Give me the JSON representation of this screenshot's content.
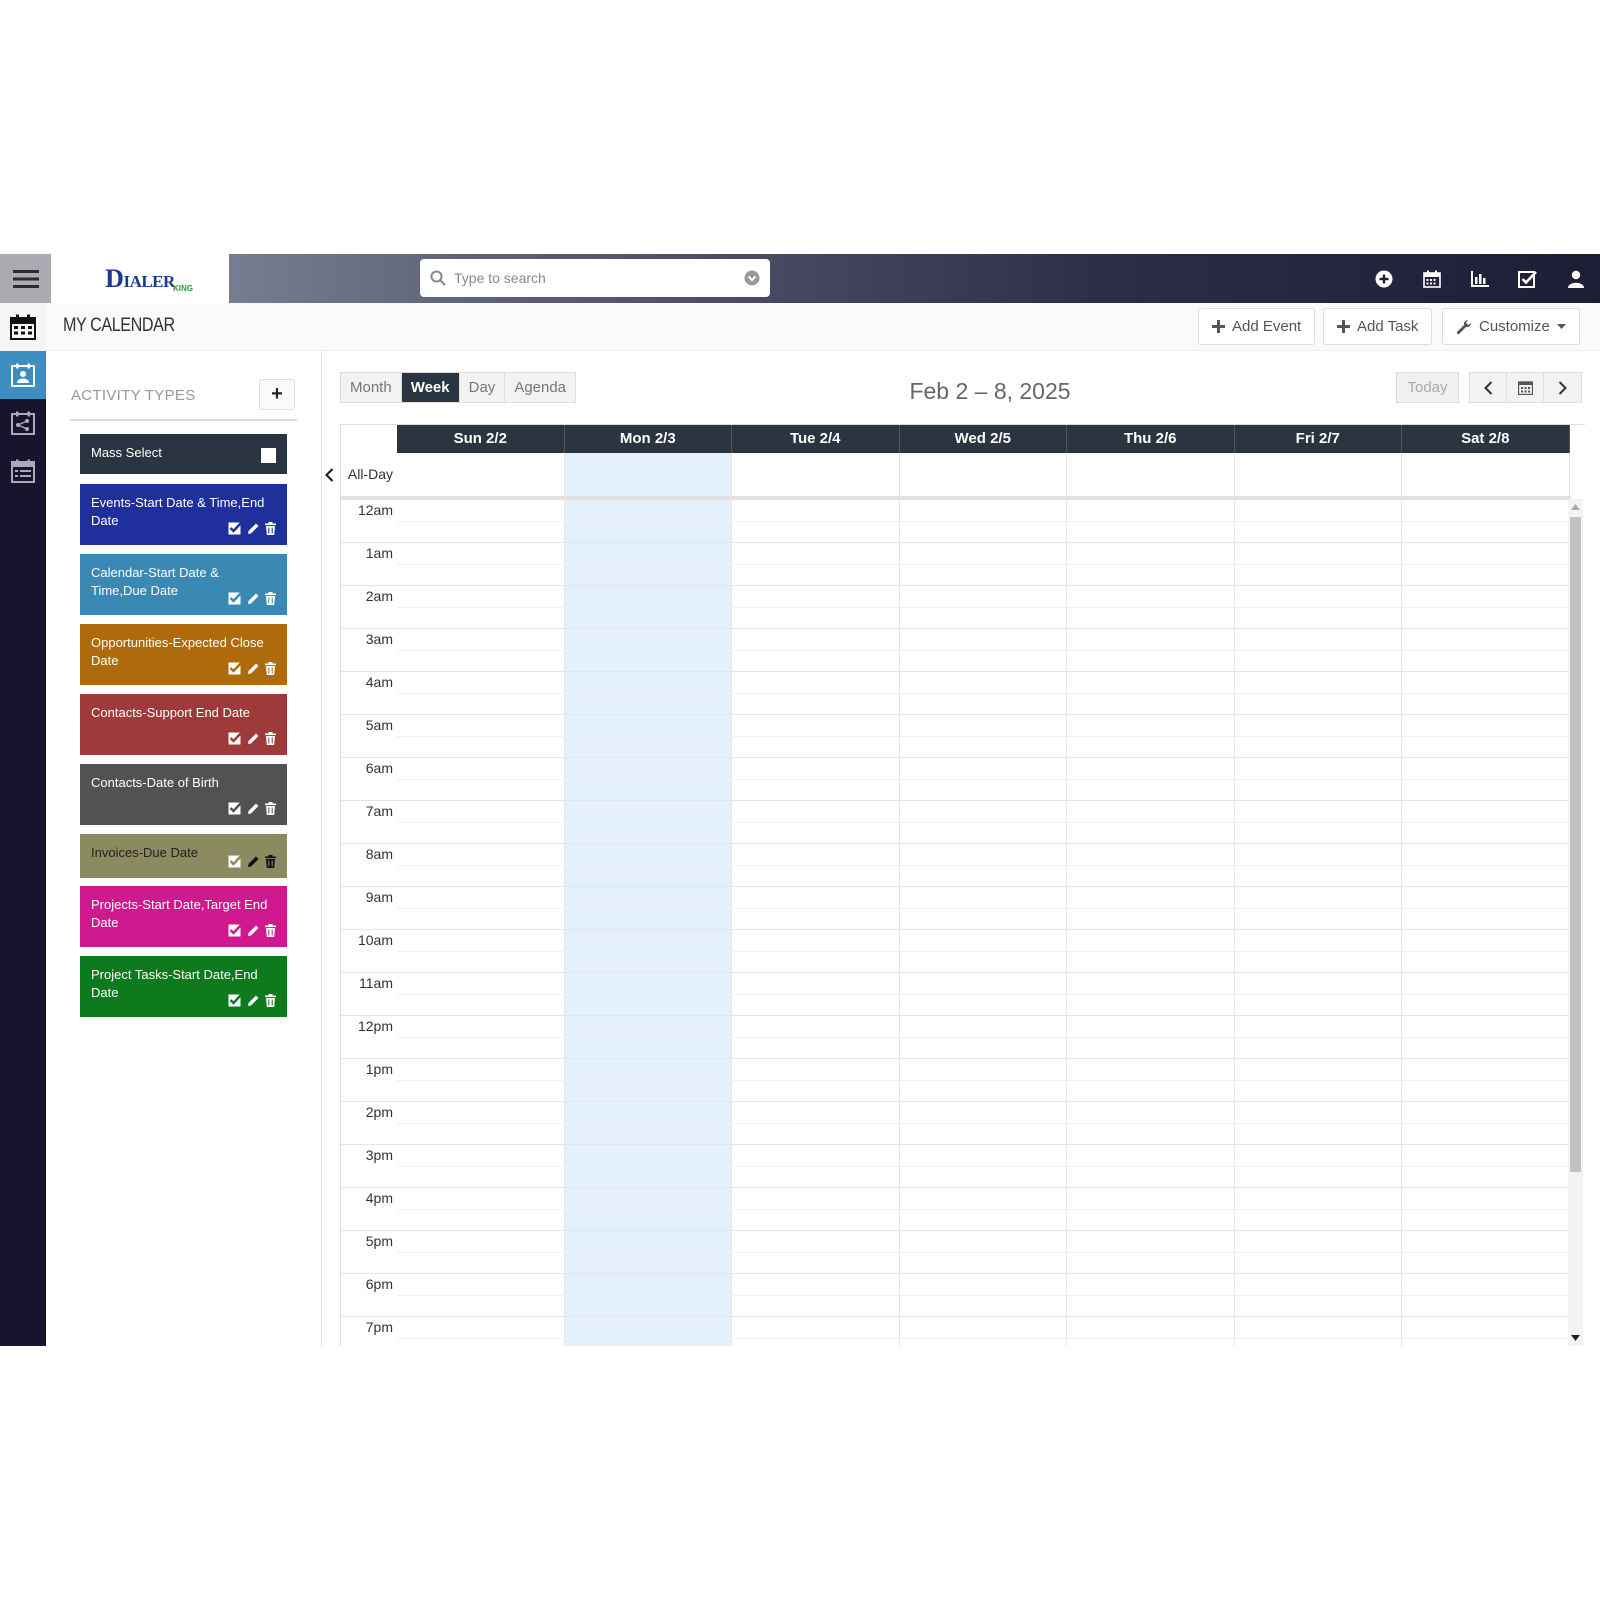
{
  "app": {
    "logo_main": "IALER",
    "logo_letter": "D",
    "logo_sub": "KING"
  },
  "search": {
    "placeholder": "Type to search"
  },
  "top_icons": [
    "plus-circle-icon",
    "calendar-icon",
    "bar-chart-icon",
    "checkbox-icon",
    "user-icon"
  ],
  "page": {
    "title": "MY CALENDAR",
    "add_event": "Add Event",
    "add_task": "Add Task",
    "customize": "Customize"
  },
  "activity": {
    "title": "ACTIVITY TYPES",
    "add_label": "+",
    "mass_select": "Mass Select",
    "items": [
      {
        "label": "Events-Start Date & Time,End Date",
        "color": "#1f2f9c"
      },
      {
        "label": "Calendar-Start Date & Time,Due Date",
        "color": "#3a89b5"
      },
      {
        "label": "Opportunities-Expected Close Date",
        "color": "#ae6a0b"
      },
      {
        "label": "Contacts-Support End Date",
        "color": "#9e3a3a"
      },
      {
        "label": "Contacts-Date of Birth",
        "color": "#525252"
      },
      {
        "label": "Invoices-Due Date",
        "color": "#8c8a60"
      },
      {
        "label": "Projects-Start Date,Target End Date",
        "color": "#d0198f"
      },
      {
        "label": "Project Tasks-Start Date,End Date",
        "color": "#0d7a1e"
      }
    ]
  },
  "calendar": {
    "views": [
      "Month",
      "Week",
      "Day",
      "Agenda"
    ],
    "active_view": "Week",
    "title": "Feb 2 – 8, 2025",
    "today_label": "Today",
    "days": [
      "Sun 2/2",
      "Mon 2/3",
      "Tue 2/4",
      "Wed 2/5",
      "Thu 2/6",
      "Fri 2/7",
      "Sat 2/8"
    ],
    "highlighted_day": "Mon 2/3",
    "all_day_label": "All-Day",
    "hours": [
      "12am",
      "1am",
      "2am",
      "3am",
      "4am",
      "5am",
      "6am",
      "7am",
      "8am",
      "9am",
      "10am",
      "11am",
      "12pm",
      "1pm",
      "2pm",
      "3pm",
      "4pm",
      "5pm",
      "6pm",
      "7pm"
    ]
  }
}
